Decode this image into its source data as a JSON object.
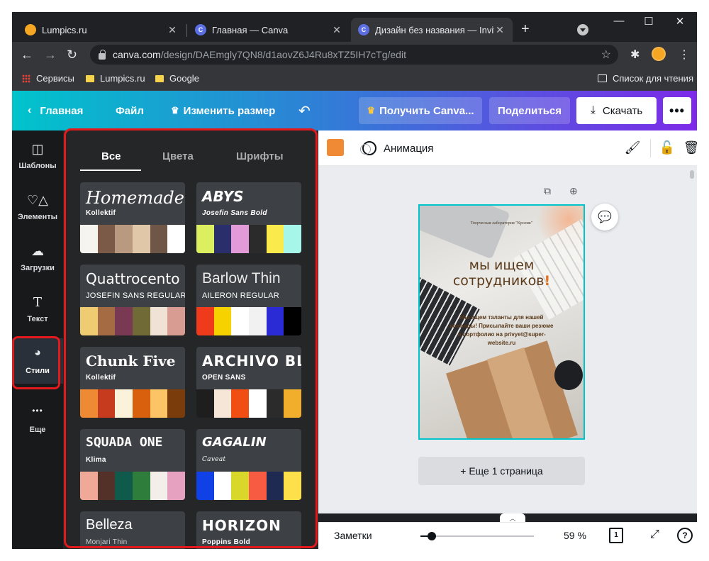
{
  "browser": {
    "tabs": [
      {
        "title": "Lumpics.ru",
        "favicon": "orange-icon",
        "favicon_color": "#f5a623",
        "active": false
      },
      {
        "title": "Главная — Canva",
        "favicon": "canva-icon",
        "favicon_color": "#5b6fe3",
        "active": false
      },
      {
        "title": "Дизайн без названия — Invitat",
        "favicon": "canva-icon",
        "favicon_color": "#5b6fe3",
        "active": true
      }
    ],
    "new_tab_label": "+",
    "window_controls": {
      "minimize": "—",
      "maximize": "☐",
      "close": "✕"
    },
    "url_host": "canva.com",
    "url_path": "/design/DAEmgly7QN8/d1aovZ6J4Ru8xTZ5IH7cTg/edit",
    "bookmarks": [
      {
        "label": "Сервисы",
        "icon": "apps-grid-icon"
      },
      {
        "label": "Lumpics.ru",
        "icon": "folder-icon"
      },
      {
        "label": "Google",
        "icon": "folder-icon"
      }
    ],
    "reading_list": "Список для чтения"
  },
  "header": {
    "home": "Главная",
    "file": "Файл",
    "resize": "Изменить размер",
    "get_pro": "Получить Canva...",
    "share": "Поделиться",
    "download": "Скачать",
    "more": "•••",
    "gradient_from": "#00c4cc",
    "gradient_to": "#7d2ae8"
  },
  "rail": [
    {
      "label": "Шаблоны",
      "icon": "templates-icon",
      "glyph": "◫",
      "active": false
    },
    {
      "label": "Элементы",
      "icon": "elements-icon",
      "glyph": "♡△",
      "active": false
    },
    {
      "label": "Загрузки",
      "icon": "upload-cloud-icon",
      "glyph": "☁",
      "active": false
    },
    {
      "label": "Текст",
      "icon": "text-icon",
      "glyph": "T",
      "active": false
    },
    {
      "label": "Стили",
      "icon": "palette-icon",
      "glyph": "🎨",
      "active": true
    },
    {
      "label": "Еще",
      "icon": "more-dots-icon",
      "glyph": "•••",
      "active": false
    }
  ],
  "styles_panel": {
    "tabs": [
      {
        "label": "Все",
        "active": true
      },
      {
        "label": "Цвета",
        "active": false
      },
      {
        "label": "Шрифты",
        "active": false
      }
    ],
    "cards": [
      {
        "heading": "Homemade Apple",
        "sub": "Kollektif",
        "heading_font": "serif-italic",
        "colors": [
          "#f6f4ef",
          "#7b5a48",
          "#b99a80",
          "#e0c7a8",
          "#6f5747",
          "#ffffff"
        ]
      },
      {
        "heading": "ABYS",
        "sub": "Josefin Sans Bold",
        "heading_font": "display",
        "colors": [
          "#dbef5f",
          "#2a2f6b",
          "#e29ad9",
          "#2b2b2b",
          "#faea4c",
          "#a6f6ea"
        ]
      },
      {
        "heading": "Quattrocento",
        "sub": "JOSEFIN SANS REGULAR",
        "heading_font": "serif",
        "colors": [
          "#efcb71",
          "#a56c44",
          "#7a3953",
          "#6f6a36",
          "#f1e2d6",
          "#d89c93"
        ]
      },
      {
        "heading": "Barlow Thin",
        "sub": "AILERON REGULAR",
        "heading_font": "thin",
        "colors": [
          "#ef3a1c",
          "#f6d300",
          "#ffffff",
          "#f1f1f1",
          "#2a2bd5",
          "#000000"
        ]
      },
      {
        "heading": "Chunk Five",
        "sub": "Kollektif",
        "heading_font": "slab",
        "colors": [
          "#ef8a34",
          "#c63a1e",
          "#fbf3d9",
          "#d9600d",
          "#fdc466",
          "#7a3c0a"
        ]
      },
      {
        "heading": "ARCHIVO BLACK",
        "sub": "OPEN SANS",
        "heading_font": "heavy",
        "colors": [
          "#1e1e1e",
          "#f6e6d8",
          "#f04e12",
          "#ffffff",
          "#2b2b2b",
          "#f0ae2c"
        ]
      },
      {
        "heading": "SQUADA ONE",
        "sub": "Klima",
        "heading_font": "condensed",
        "colors": [
          "#f0a996",
          "#533028",
          "#0f5a4b",
          "#2f7d3a",
          "#f3eeea",
          "#e7a1c0"
        ]
      },
      {
        "heading": "GAGALIN",
        "sub": "Caveat",
        "heading_font": "rounded",
        "colors": [
          "#1041e6",
          "#ffffff",
          "#d8d72a",
          "#f75b42",
          "#1f2a52",
          "#fde04a"
        ]
      },
      {
        "heading": "Belleza",
        "sub": "Monjari Thin",
        "heading_font": "light",
        "colors": []
      },
      {
        "heading": "HORIZON",
        "sub": "Poppins Bold",
        "heading_font": "wide",
        "colors": []
      }
    ]
  },
  "editor": {
    "color_swatch": "#f08a34",
    "animation": "Анимация",
    "design": {
      "small_line": "Творческая лаборатория \"Кролик\"",
      "headline_1": "мы ищем",
      "headline_2": "сотрудников",
      "headline_mark": "!",
      "body": "Мы ищем таланты для нашей команды! Присылайте ваши резюме и портфолио на privyet@super-website.ru"
    },
    "add_page": "+ Еще 1 страница",
    "footer": {
      "notes": "Заметки",
      "zoom_label": "59 %",
      "zoom_percent": 59,
      "page_count": "1",
      "help": "?"
    }
  }
}
